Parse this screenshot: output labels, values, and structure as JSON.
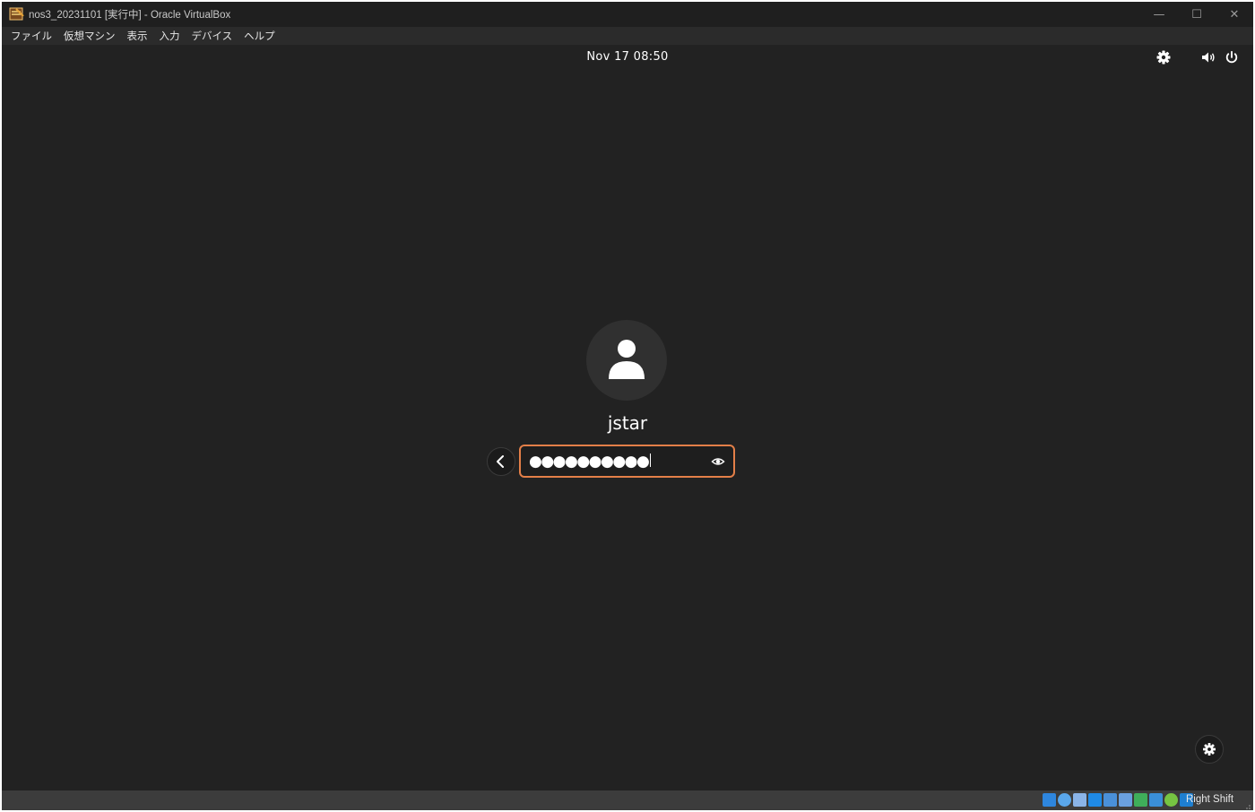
{
  "window": {
    "title": "nos3_20231101 [実行中] - Oracle VirtualBox",
    "controls": {
      "minimize": "—",
      "maximize": "☐",
      "close": "✕"
    }
  },
  "menu": {
    "items": [
      {
        "label": "ファイル"
      },
      {
        "label": "仮想マシン"
      },
      {
        "label": "表示"
      },
      {
        "label": "入力"
      },
      {
        "label": "デバイス"
      },
      {
        "label": "ヘルプ"
      }
    ]
  },
  "guest": {
    "clock": "Nov 17  08:50",
    "login": {
      "username": "jstar",
      "password_masked": "●●●●●●●●●●"
    },
    "icons": {
      "top_left": "settings-gear-icon",
      "top_right": [
        "volume-icon",
        "power-icon"
      ],
      "avatar": "user-silhouette-icon",
      "back": "chevron-left-icon",
      "reveal": "eye-icon",
      "accessibility": "accessibility-gear-icon"
    },
    "colors": {
      "background": "#222222",
      "field_border": "#e37f48"
    }
  },
  "statusbar": {
    "host_key": "Right Shift",
    "icons": [
      "hard-disk-icon",
      "optical-drive-icon",
      "network-icon",
      "usb-icon",
      "shared-folder-icon",
      "display-icon",
      "recording-icon",
      "cpu-icon",
      "mouse-integration-icon",
      "keyboard-icon"
    ]
  }
}
